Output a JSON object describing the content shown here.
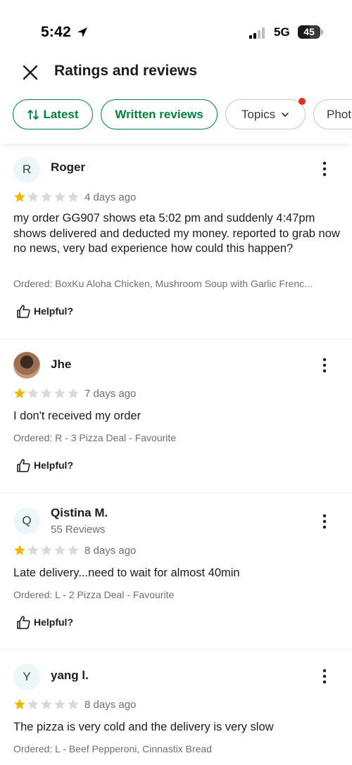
{
  "status_bar": {
    "time": "5:42",
    "network": "5G",
    "battery": "45"
  },
  "header": {
    "title": "Ratings and reviews"
  },
  "filters": [
    {
      "label": "Latest",
      "icon": "sort-icon",
      "active": true
    },
    {
      "label": "Written reviews",
      "active": true
    },
    {
      "label": "Topics",
      "icon": "chevron-down-icon",
      "active": false,
      "notification_dot": true
    },
    {
      "label": "Phot",
      "active": false
    }
  ],
  "colors": {
    "accent": "#00803c",
    "star_filled": "#f5b400",
    "star_empty": "#d9d9d9",
    "notification_dot": "#e0301e"
  },
  "helpful_label": "Helpful?",
  "reviews": [
    {
      "initial": "R",
      "name": "Roger",
      "rating": 1,
      "max_rating": 5,
      "date": "4 days ago",
      "text": "my order GG907 shows eta 5:02 pm and suddenly 4:47pm shows delivered and deducted my money. reported to grab now no news, very bad experience how could this happen?",
      "ordered": "Ordered: BoxKu Aloha Chicken, Mushroom Soup with Garlic Frenc..."
    },
    {
      "initial": "",
      "name": "Jhe",
      "rating": 1,
      "max_rating": 5,
      "date": "7 days ago",
      "text": "I don't received my order",
      "ordered": "Ordered: R - 3 Pizza Deal - Favourite"
    },
    {
      "initial": "Q",
      "name": "Qistina M.",
      "sub": "55 Reviews",
      "rating": 1,
      "max_rating": 5,
      "date": "8 days ago",
      "text": "Late delivery...need to wait for almost 40min",
      "ordered": "Ordered: L - 2 Pizza Deal - Favourite"
    },
    {
      "initial": "Y",
      "name": "yang l.",
      "rating": 1,
      "max_rating": 5,
      "date": "8 days ago",
      "text": "The pizza is very cold and the delivery is very slow",
      "ordered": "Ordered: L - Beef Pepperoni, Cinnastix Bread"
    }
  ]
}
